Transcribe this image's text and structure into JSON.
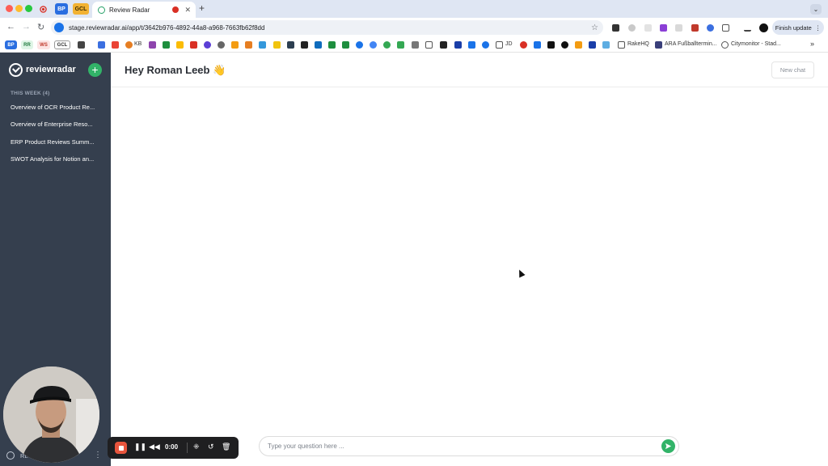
{
  "browser": {
    "pinned_tabs": [
      {
        "label": "BP",
        "bg": "#2a6ee0",
        "fg": "#ffffff"
      },
      {
        "label": "GCL",
        "bg": "#f2b233",
        "fg": "#3a2a00"
      }
    ],
    "active_tab_title": "Review Radar",
    "url": "stage.reviewradar.ai/app/t/3642b976-4892-44a8-a968-7663fb62f8dd",
    "finish_update_label": "Finish update",
    "bookmark_badges": [
      "BP",
      "RR",
      "WS",
      "GCL"
    ],
    "bookmark_labels": {
      "kb": "KB",
      "jd": "JD",
      "rakehq": "RakeHQ",
      "ara": "ARA Fußballtermin...",
      "citymonitor": "Citymonitor - Stad..."
    }
  },
  "sidebar": {
    "brand": "reviewradar",
    "section_label": "THIS WEEK (4)",
    "chats": [
      "Overview of OCR Product Re...",
      "Overview of Enterprise Reso...",
      "ERP Product Reviews Summ...",
      "SWOT Analysis for Notion an..."
    ],
    "user_name": "RL"
  },
  "main": {
    "greeting": "Hey Roman Leeb 👋",
    "new_chat_label": "New chat",
    "input_placeholder": "Type your question here ..."
  },
  "recorder": {
    "time": "0:00"
  },
  "colors": {
    "sidebar_bg": "#353f4e",
    "accent_green": "#32b368",
    "record_red": "#e8553d"
  }
}
